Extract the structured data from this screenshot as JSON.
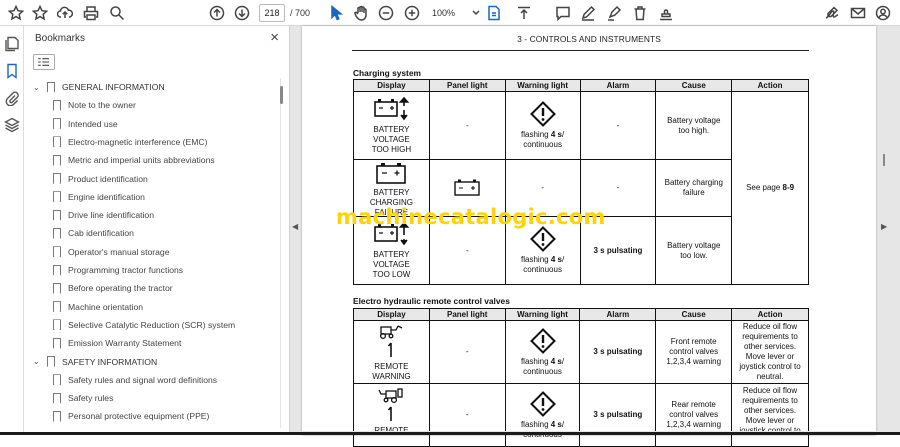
{
  "toolbar": {
    "page_current": "218",
    "page_total": "/ 700",
    "zoom": "100%"
  },
  "bookmarks": {
    "title": "Bookmarks",
    "close": "×",
    "items": [
      {
        "label": "GENERAL INFORMATION",
        "level": 0
      },
      {
        "label": "Note to the owner",
        "level": 1
      },
      {
        "label": "Intended use",
        "level": 1
      },
      {
        "label": "Electro-magnetic interference (EMC)",
        "level": 1
      },
      {
        "label": "Metric and imperial units abbreviations",
        "level": 1
      },
      {
        "label": "Product identification",
        "level": 1
      },
      {
        "label": "Engine identification",
        "level": 1
      },
      {
        "label": "Drive line identification",
        "level": 1
      },
      {
        "label": "Cab identification",
        "level": 1
      },
      {
        "label": "Operator's manual storage",
        "level": 1
      },
      {
        "label": "Programming tractor functions",
        "level": 1
      },
      {
        "label": "Before operating the tractor",
        "level": 1
      },
      {
        "label": "Machine orientation",
        "level": 1
      },
      {
        "label": "Selective Catalytic Reduction (SCR) system",
        "level": 1
      },
      {
        "label": "Emission Warranty Statement",
        "level": 1
      },
      {
        "label": "SAFETY INFORMATION",
        "level": 0
      },
      {
        "label": "Safety rules and signal word definitions",
        "level": 1
      },
      {
        "label": "Safety rules",
        "level": 1
      },
      {
        "label": "Personal protective equipment (PPE)",
        "level": 1
      }
    ]
  },
  "document": {
    "header": "3 - CONTROLS AND INSTRUMENTS",
    "watermark": "machinecatalogic.com",
    "headers": [
      "Display",
      "Panel light",
      "Warning light",
      "Alarm",
      "Cause",
      "Action"
    ],
    "section1": {
      "title": "Charging system",
      "rows": [
        {
          "display": [
            "BATTERY",
            "VOLTAGE",
            "TOO HIGH"
          ],
          "panel": "-",
          "warning": [
            "flashing ",
            "4 s",
            "/",
            "continuous"
          ],
          "alarm": "-",
          "cause": [
            "Battery voltage",
            "too high."
          ]
        },
        {
          "display": [
            "BATTERY",
            "CHARGING",
            "FAILURE"
          ],
          "panel": "",
          "warning": [
            "-"
          ],
          "alarm": "-",
          "cause": [
            "Battery charging",
            "failure"
          ]
        },
        {
          "display": [
            "BATTERY",
            "VOLTAGE",
            "TOO LOW"
          ],
          "panel": "-",
          "warning": [
            "flashing ",
            "4 s",
            "/",
            "continuous"
          ],
          "alarm": "3 s pulsating",
          "cause": [
            "Battery voltage",
            "too low."
          ]
        }
      ],
      "action_prefix": "See page ",
      "action_page": "8-9"
    },
    "section2": {
      "title": "Electro hydraulic remote control valves",
      "rows": [
        {
          "display": [
            "REMOTE",
            "WARNING"
          ],
          "panel": "-",
          "warning": [
            "flashing ",
            "4 s",
            "/",
            "continuous"
          ],
          "alarm": "3 s pulsating",
          "cause": [
            "Front remote",
            "control valves",
            "1,2,3,4 warning"
          ],
          "action": [
            "Reduce oil flow",
            "requirements to",
            "other services.",
            "Move lever or",
            "joystick control to",
            "neutral."
          ]
        },
        {
          "display": [
            "REMOTE"
          ],
          "panel": "-",
          "warning": [
            "flashing ",
            "4 s",
            "/",
            "continuous"
          ],
          "alarm": "3 s pulsating",
          "cause": [
            "Rear remote",
            "control valves",
            "1,2,3,4 warning"
          ],
          "action": [
            "Reduce oil flow",
            "requirements to",
            "other services.",
            "Move lever or",
            "joystick control to"
          ]
        }
      ]
    }
  }
}
